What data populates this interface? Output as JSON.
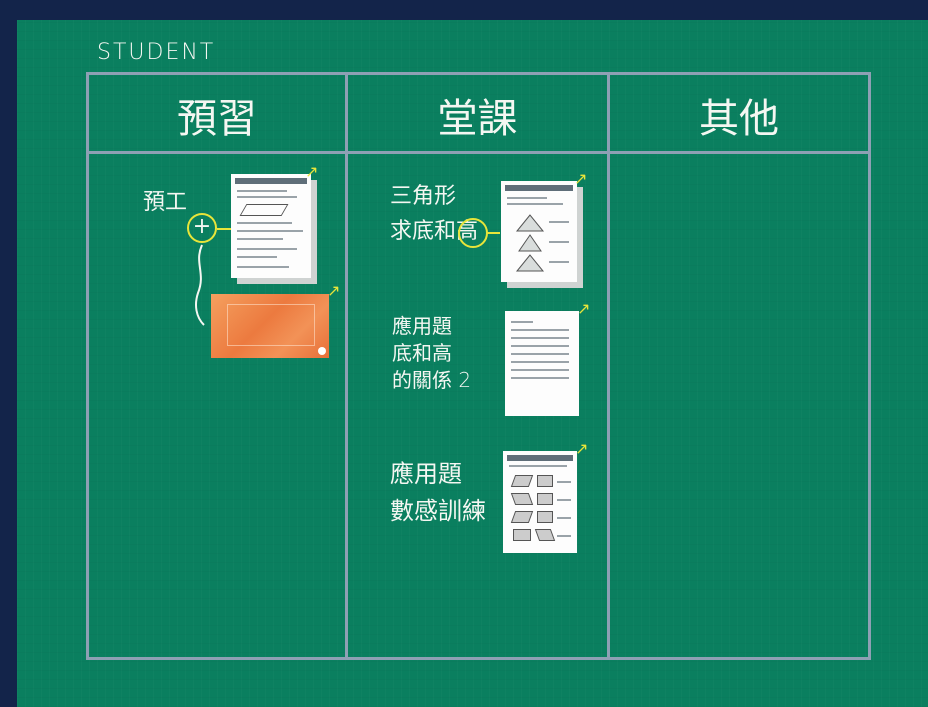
{
  "board": {
    "label": "STUDENT",
    "columns": [
      {
        "label": "預習"
      },
      {
        "label": "堂課"
      },
      {
        "label": "其他"
      }
    ]
  },
  "preview": {
    "note": "預工"
  },
  "lesson": {
    "item1": {
      "line1": "三角形",
      "line2": "求底和高"
    },
    "item2": {
      "line1": "應用題",
      "line2": "底和高",
      "line3": "的關係 2"
    },
    "item3": {
      "line1": "應用題",
      "line2": "數感訓練"
    }
  },
  "colors": {
    "board": "#0a7f5f",
    "frame": "#13244a",
    "grid": "#8ea0b4",
    "accent": "#e8e53a"
  },
  "icons": {
    "open": "arrow-up-right-icon",
    "link": "plus-circle-icon"
  }
}
